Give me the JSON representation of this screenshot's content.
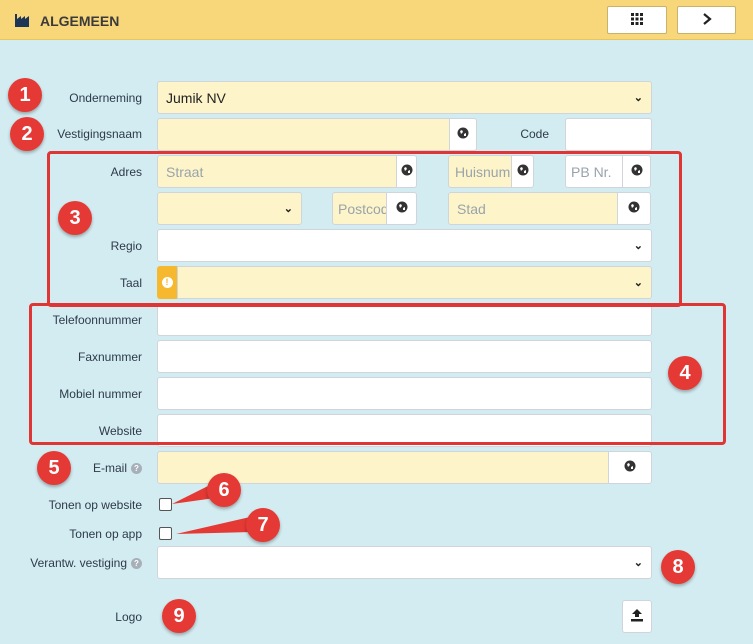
{
  "header": {
    "title": "ALGEMEEN",
    "icon": "factory-icon",
    "buttons": [
      {
        "icon": "grid-icon"
      },
      {
        "icon": "chevron-right-icon",
        "label": ">"
      }
    ]
  },
  "form": {
    "onderneming": {
      "label": "Onderneming",
      "value": "Jumik NV"
    },
    "vestigingsnaam": {
      "label": "Vestigingsnaam",
      "value": ""
    },
    "code": {
      "label": "Code",
      "value": ""
    },
    "adres": {
      "label": "Adres",
      "straat_placeholder": "Straat",
      "huisnummer_placeholder": "Huisnum",
      "pbnr_placeholder": "PB Nr."
    },
    "adres2": {
      "land_value": "",
      "postcode_placeholder": "Postcod",
      "stad_placeholder": "Stad"
    },
    "regio": {
      "label": "Regio",
      "value": ""
    },
    "taal": {
      "label": "Taal",
      "value": "",
      "warning_icon": "!"
    },
    "telefoon": {
      "label": "Telefoonnummer",
      "value": ""
    },
    "fax": {
      "label": "Faxnummer",
      "value": ""
    },
    "mobiel": {
      "label": "Mobiel nummer",
      "value": ""
    },
    "website": {
      "label": "Website",
      "value": ""
    },
    "email": {
      "label": "E-mail",
      "value": "",
      "help": "?"
    },
    "tonen_website": {
      "label": "Tonen op website",
      "checked": false
    },
    "tonen_app": {
      "label": "Tonen op app",
      "checked": false
    },
    "verantw": {
      "label": "Verantw. vestiging",
      "value": "",
      "help": "?"
    },
    "logo": {
      "label": "Logo"
    }
  },
  "annotations": [
    "1",
    "2",
    "3",
    "4",
    "5",
    "6",
    "7",
    "8",
    "9"
  ],
  "colors": {
    "header": "#f8d77a",
    "background": "#d3ecf1",
    "required_field": "#fdf5c9",
    "marker": "#e53935"
  }
}
